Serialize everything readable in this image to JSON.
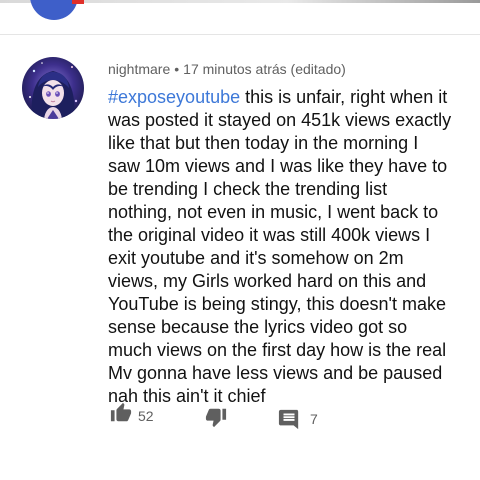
{
  "comment": {
    "author": "nightmare",
    "separator": "•",
    "timestamp": "17 minutos atrás (editado)",
    "hashtag": "#exposeyoutube",
    "text": " this is unfair, right when it was posted it stayed on 451k views exactly like that but then today in the morning I saw 10m views and I was like they have to be trending I check the trending list nothing, not even in music, I went back to the original video it was still 400k views I exit youtube and it's somehow on 2m views, my Girls worked hard on this and YouTube is being stingy, this doesn't make sense because the lyrics video got so much views on the first day how is the real Mv gonna have less views and be paused nah this ain't it chief",
    "likes": "52",
    "replies": "7"
  },
  "icons": {
    "like": "thumbs-up-icon",
    "dislike": "thumbs-down-icon",
    "reply": "comment-icon",
    "avatar": "avatar"
  },
  "colors": {
    "hashtag": "#3d78d8",
    "meta_text": "#606060",
    "body_text": "#121212",
    "icon": "#5f5f5f"
  }
}
